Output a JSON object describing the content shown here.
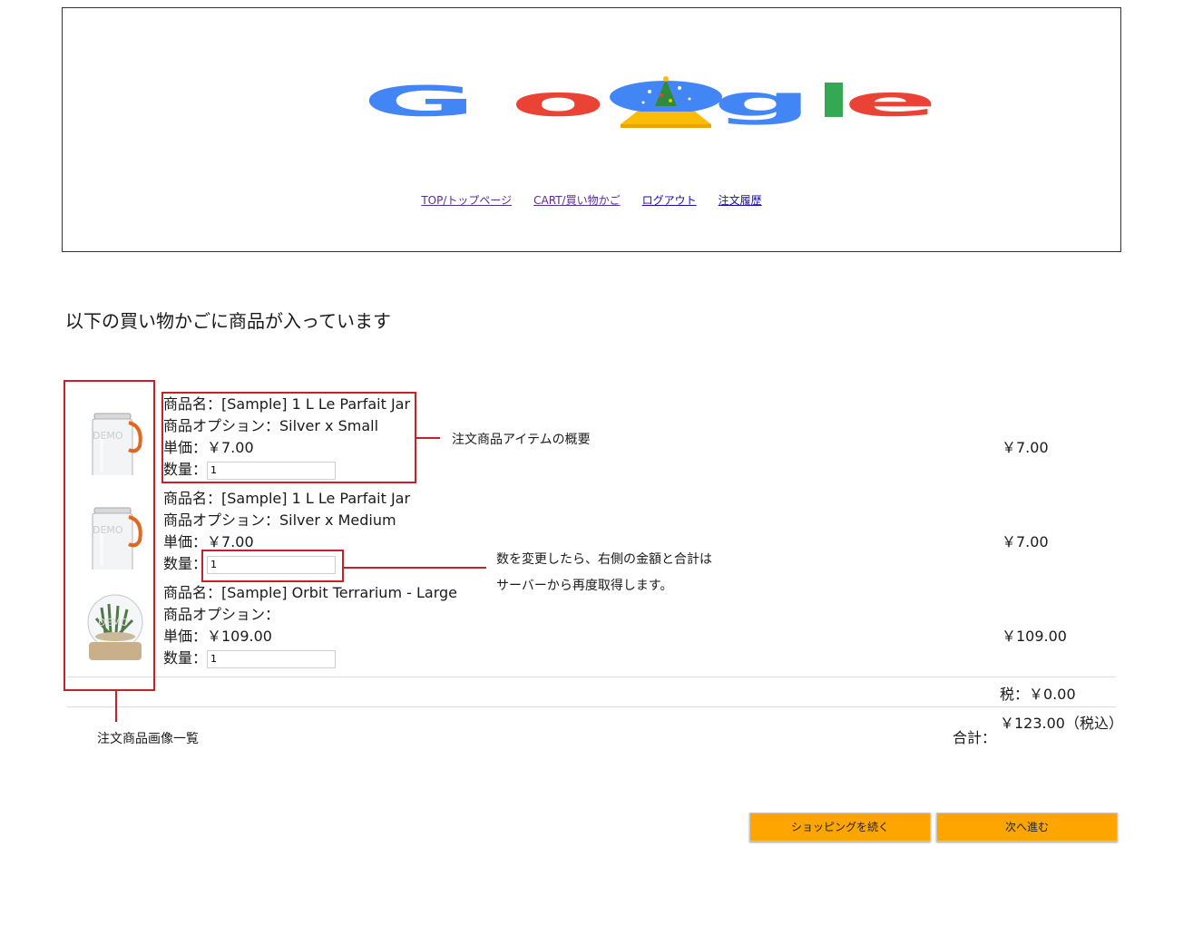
{
  "logo": {
    "letters": [
      "G",
      "o",
      "o",
      "g",
      "l",
      "e"
    ],
    "colors": [
      "#4285f4",
      "#ea4335",
      "#fbbc05",
      "#4285f4",
      "#34a853",
      "#ea4335"
    ]
  },
  "nav": {
    "items": [
      "TOP/トップページ",
      "CART/買い物かご",
      "ログアウト",
      "注文履歴"
    ]
  },
  "page": {
    "title": "以下の買い物かごに商品が入っています"
  },
  "items": [
    {
      "name": "商品名：[Sample] 1 L Le Parfait Jar",
      "option": "商品オプション：Silver  x  Small",
      "unit_price": "単価：￥7.00",
      "qty_label": "数量：",
      "qty_value": "1",
      "price": "￥7.00",
      "image": "jar-image"
    },
    {
      "name": "商品名：[Sample] 1 L Le Parfait Jar",
      "option": "商品オプション：Silver  x  Medium",
      "unit_price": "単価：￥7.00",
      "qty_label": "数量：",
      "qty_value": "1",
      "price": "￥7.00",
      "image": "jar-image"
    },
    {
      "name": "商品名：[Sample] Orbit Terrarium - Large",
      "option": "商品オプション：",
      "unit_price": "単価：￥109.00",
      "qty_label": "数量：",
      "qty_value": "1",
      "price": "￥109.00",
      "image": "terrarium-image"
    }
  ],
  "summary": {
    "tax": "税：￥0.00",
    "total_label": "合計：",
    "total_value": "￥123.00（税込）"
  },
  "buttons": {
    "continue": "ショッピングを続く",
    "next": "次へ進む"
  },
  "annotations": {
    "summary_note": "注文商品アイテムの概要",
    "qty_note_1": "数を変更したら、右側の金額と合計は",
    "qty_note_2": "サーバーから再度取得します。",
    "images_note": "注文商品画像一覧",
    "color": "#c8202a"
  },
  "thumb_watermark": "DEMO"
}
